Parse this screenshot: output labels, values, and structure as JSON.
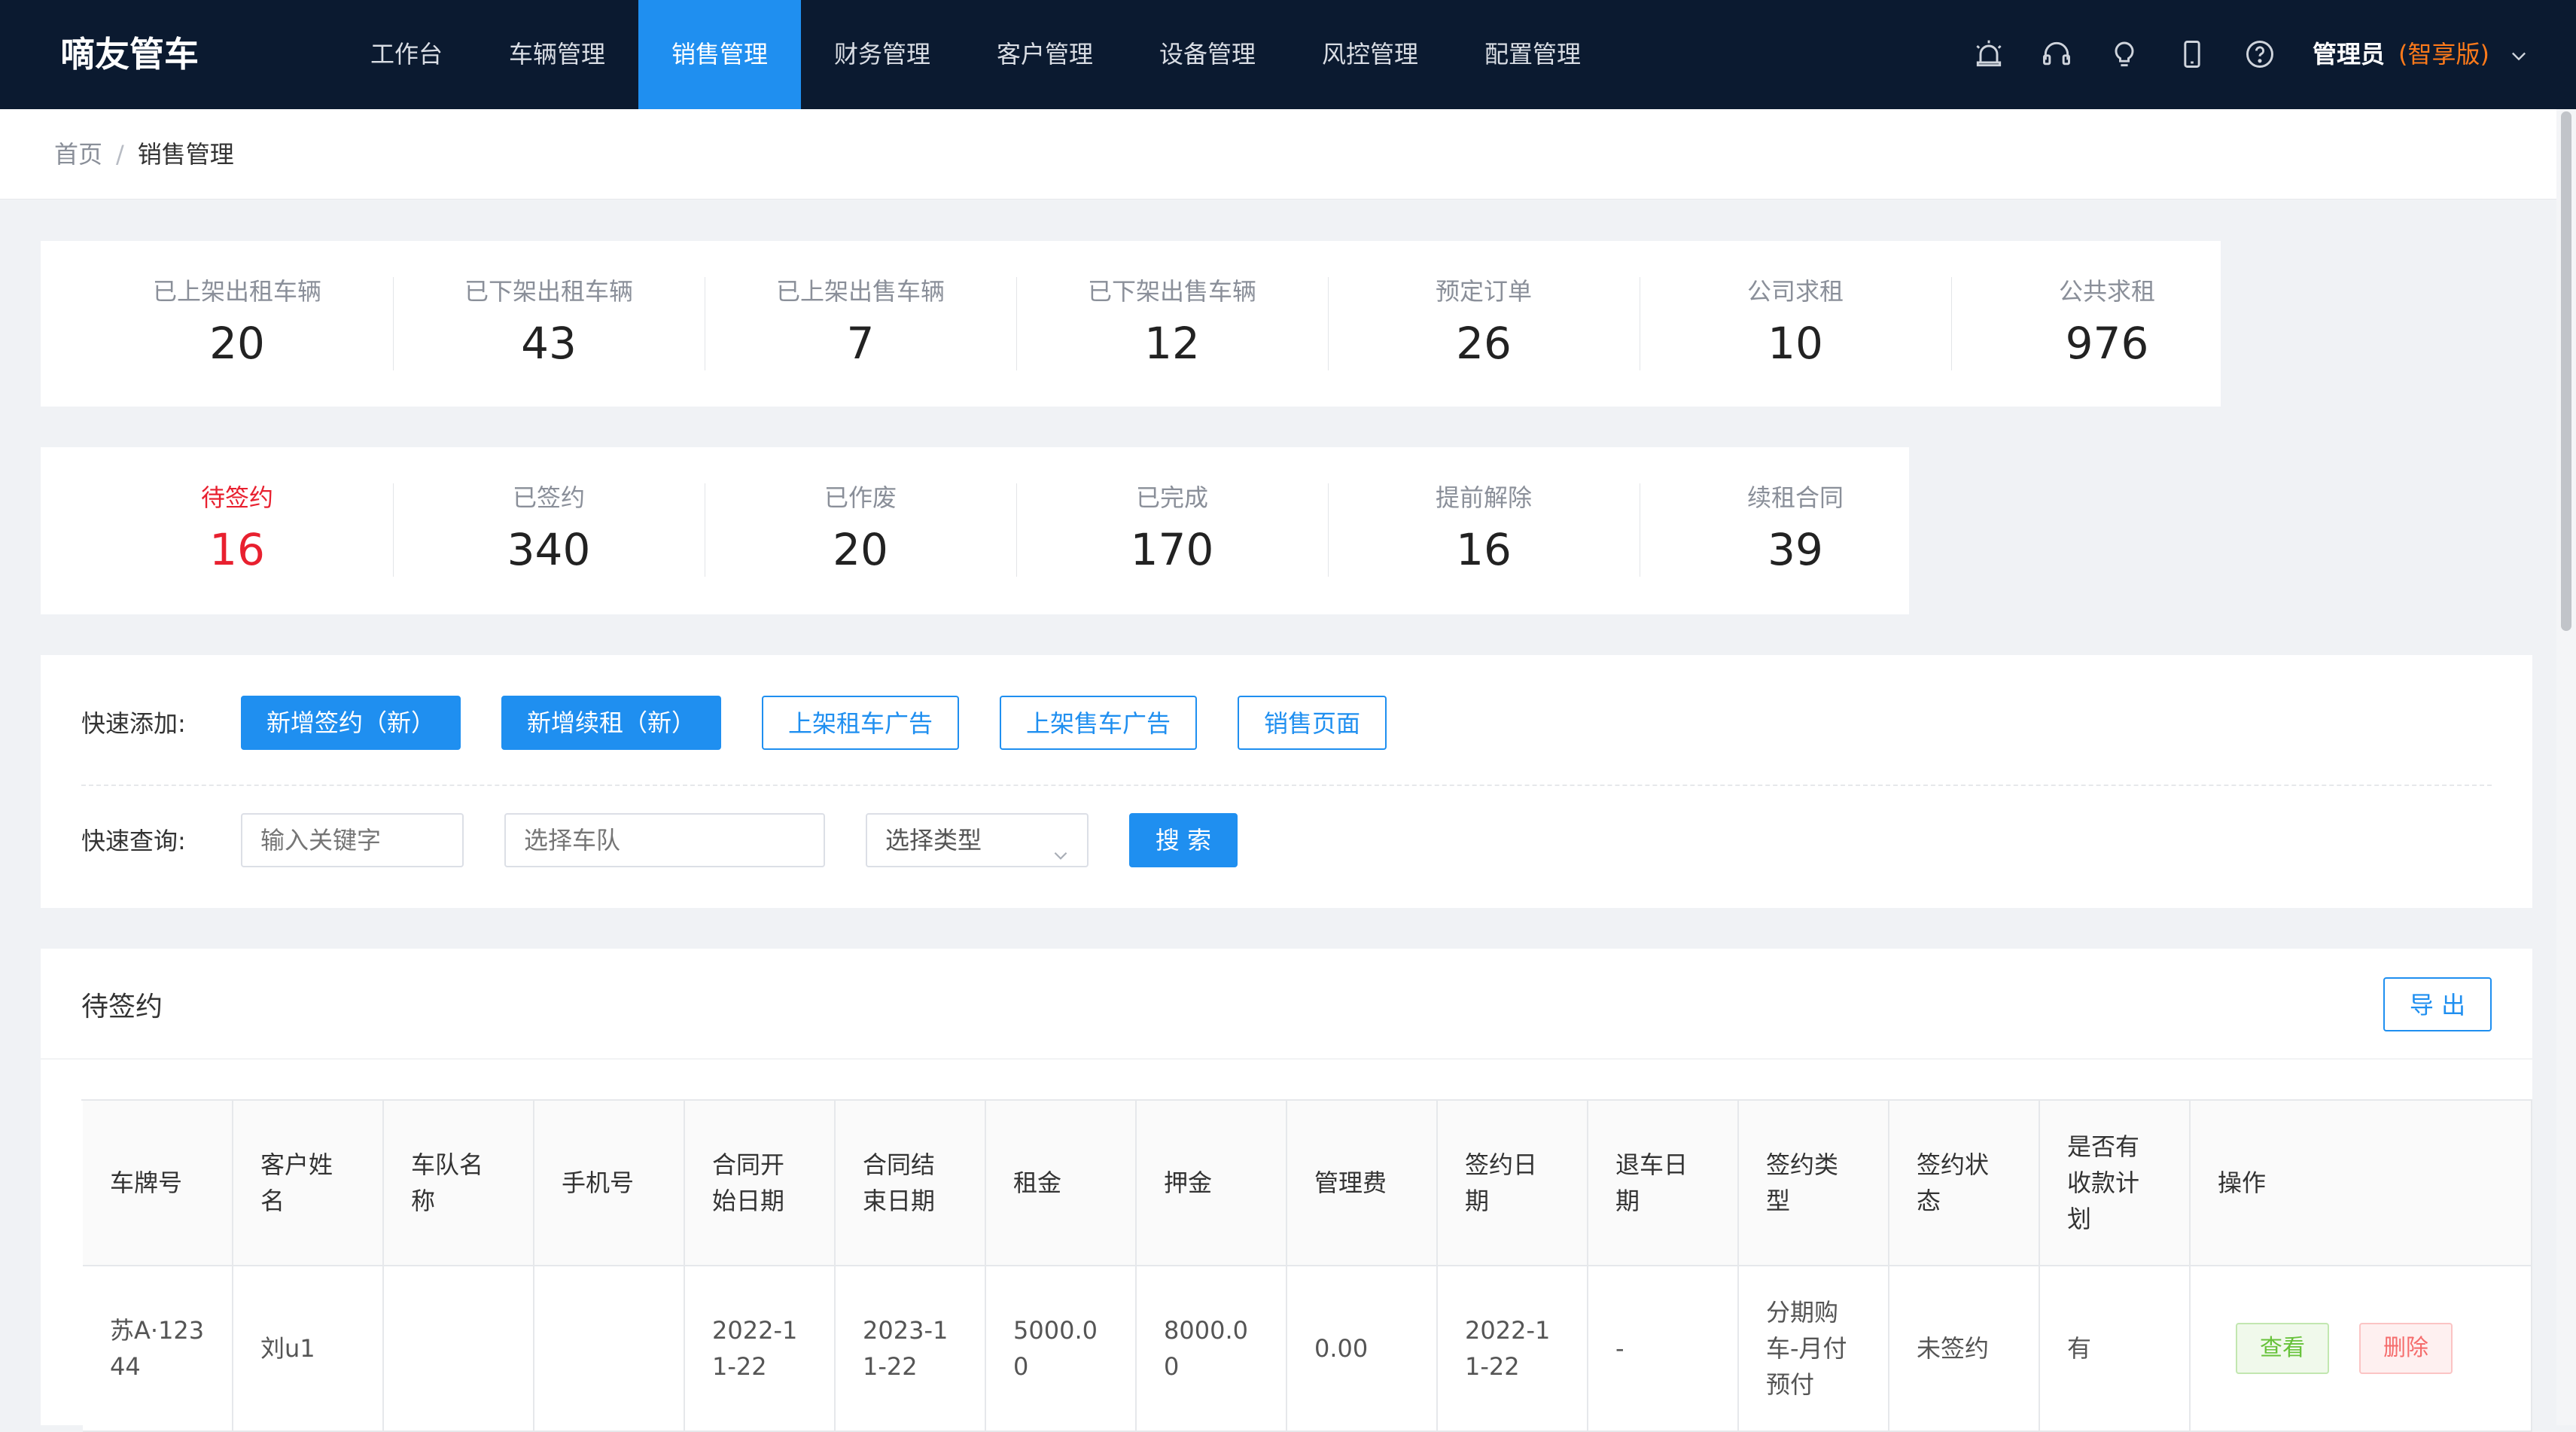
{
  "app": {
    "brand": "嘀友管车"
  },
  "nav": {
    "items": [
      "工作台",
      "车辆管理",
      "销售管理",
      "财务管理",
      "客户管理",
      "设备管理",
      "风控管理",
      "配置管理"
    ],
    "active": "销售管理",
    "icons": [
      "alarm-icon",
      "headset-icon",
      "bulb-icon",
      "mobile-icon",
      "help-icon"
    ],
    "user": {
      "name": "管理员",
      "edition": "(智享版)"
    }
  },
  "colors": {
    "nav_bg": "#0b1a30",
    "accent": "#1f8ff0",
    "highlight": "#e8202f",
    "edition": "#ff7a1a"
  },
  "breadcrumb": {
    "home": "首页",
    "separator": "/",
    "current": "销售管理"
  },
  "stats_row1": [
    {
      "label": "已上架出租车辆",
      "value": "20"
    },
    {
      "label": "已下架出租车辆",
      "value": "43"
    },
    {
      "label": "已上架出售车辆",
      "value": "7"
    },
    {
      "label": "已下架出售车辆",
      "value": "12"
    },
    {
      "label": "预定订单",
      "value": "26"
    },
    {
      "label": "公司求租",
      "value": "10"
    },
    {
      "label": "公共求租",
      "value": "976"
    }
  ],
  "stats_row2": [
    {
      "label": "待签约",
      "value": "16",
      "highlight": true
    },
    {
      "label": "已签约",
      "value": "340"
    },
    {
      "label": "已作废",
      "value": "20"
    },
    {
      "label": "已完成",
      "value": "170"
    },
    {
      "label": "提前解除",
      "value": "16"
    },
    {
      "label": "续租合同",
      "value": "39"
    }
  ],
  "quick_add": {
    "label": "快速添加:",
    "buttons": [
      "新增签约（新）",
      "新增续租（新）",
      "上架租车广告",
      "上架售车广告",
      "销售页面"
    ]
  },
  "quick_search": {
    "label": "快速查询:",
    "keyword_placeholder": "输入关键字",
    "fleet_placeholder": "选择车队",
    "type_select": "选择类型",
    "search_button": "搜 索"
  },
  "table": {
    "title": "待签约",
    "export_button": "导 出",
    "columns": [
      "车牌号",
      "客户姓名",
      "车队名称",
      "手机号",
      "合同开始日期",
      "合同结束日期",
      "租金",
      "押金",
      "管理费",
      "签约日期",
      "退车日期",
      "签约类型",
      "签约状态",
      "是否有收款计划",
      "操作"
    ],
    "rows": [
      {
        "cells": [
          "苏A·12344",
          "刘u1",
          "",
          "",
          "2022-11-22",
          "2023-11-22",
          "5000.00",
          "8000.00",
          "0.00",
          "2022-11-22",
          "-",
          "分期购车-月付预付",
          "未签约",
          "有"
        ],
        "actions": [
          "查看",
          "删除"
        ]
      }
    ]
  }
}
